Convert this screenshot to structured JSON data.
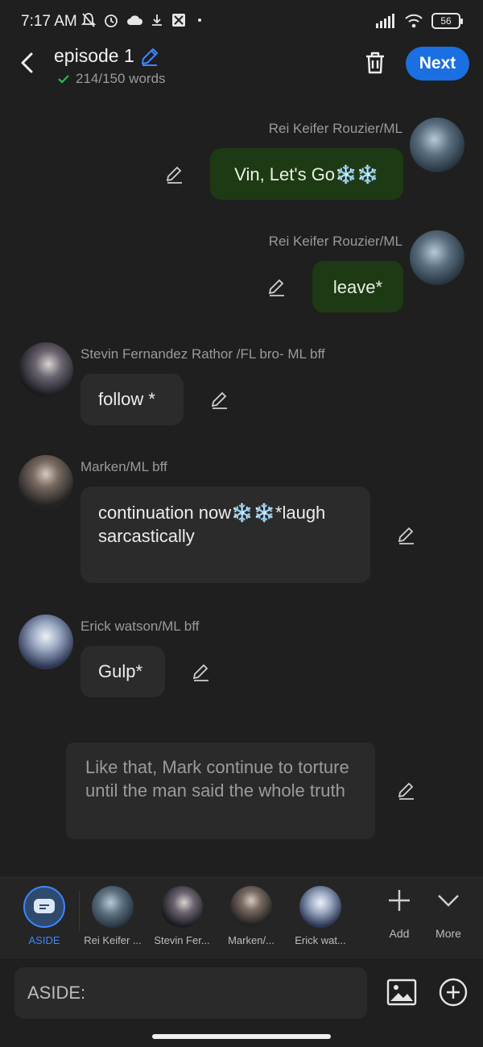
{
  "status_bar": {
    "time": "7:17 AM",
    "battery": "56"
  },
  "header": {
    "title": "episode 1",
    "word_count": "214/150 words",
    "next_label": "Next"
  },
  "messages": [
    {
      "speaker": "Rei Keifer Rouzier/ML",
      "side": "right",
      "text": "Vin, Let's Go❄️❄️"
    },
    {
      "speaker": "Rei Keifer Rouzier/ML",
      "side": "right",
      "text": "leave*"
    },
    {
      "speaker": "Stevin Fernandez Rathor /FL bro- ML bff",
      "side": "left",
      "text": "follow *"
    },
    {
      "speaker": "Marken/ML bff",
      "side": "left",
      "text": "continuation now❄️❄️*laugh sarcastically"
    },
    {
      "speaker": "Erick watson/ML bff",
      "side": "left",
      "text": "Gulp*"
    }
  ],
  "aside_text": "Like that, Mark continue to torture until the man said the whole truth",
  "characters": [
    {
      "label": "ASIDE",
      "active": true
    },
    {
      "label": "Rei Keifer ..."
    },
    {
      "label": "Stevin Fer..."
    },
    {
      "label": "Marken/..."
    },
    {
      "label": "Erick wat..."
    }
  ],
  "tools": {
    "add_label": "Add",
    "more_label": "More"
  },
  "input": {
    "placeholder": "ASIDE:"
  },
  "colors": {
    "accent": "#1b6fe0",
    "my_bubble": "#1e3a14",
    "their_bubble": "#2b2b2b",
    "background": "#1f1f1f"
  }
}
